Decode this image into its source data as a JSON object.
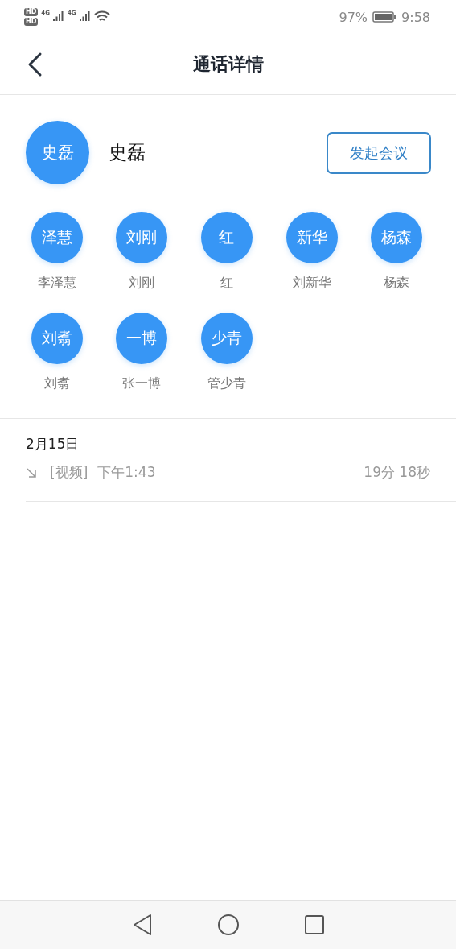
{
  "status_bar": {
    "sim_labels": [
      "HD",
      "HD"
    ],
    "network_labels": [
      "4G",
      "4G"
    ],
    "battery": "97%",
    "time": "9:58"
  },
  "nav": {
    "title": "通话详情"
  },
  "contact": {
    "avatar": "史磊",
    "name": "史磊",
    "action": "发起会议"
  },
  "participants": [
    {
      "avatar": "泽慧",
      "name": "李泽慧"
    },
    {
      "avatar": "刘刚",
      "name": "刘刚"
    },
    {
      "avatar": "红",
      "name": "红"
    },
    {
      "avatar": "新华",
      "name": "刘新华"
    },
    {
      "avatar": "杨森",
      "name": "杨森"
    },
    {
      "avatar": "刘翥",
      "name": "刘翥"
    },
    {
      "avatar": "一博",
      "name": "张一博"
    },
    {
      "avatar": "少青",
      "name": "管少青"
    }
  ],
  "history": [
    {
      "date": "2月15日",
      "calls": [
        {
          "type": "[视频]",
          "time": "下午1:43",
          "duration": "19分 18秒"
        }
      ]
    }
  ]
}
